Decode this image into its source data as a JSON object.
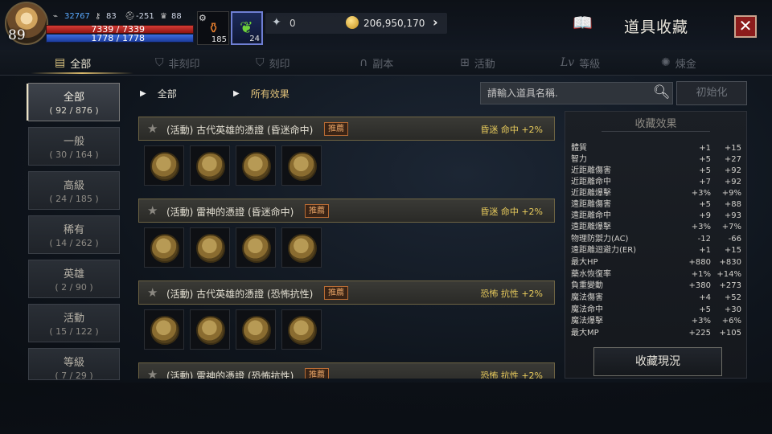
{
  "player": {
    "level": "89",
    "power": "32767",
    "stat_key": "83",
    "stat_helmet": "-251",
    "stat_trophy": "88",
    "hp": "7339 / 7339",
    "mp": "1778 / 1778"
  },
  "quick_slots": {
    "potion_count": "185",
    "herb_count": "24"
  },
  "currency": {
    "gems": "0",
    "gold": "206,950,170"
  },
  "header": {
    "title": "道具收藏"
  },
  "tabs": [
    {
      "label": "全部",
      "icon": "book-icon"
    },
    {
      "label": "非刻印",
      "icon": "shield-icon"
    },
    {
      "label": "刻印",
      "icon": "shield-icon"
    },
    {
      "label": "副本",
      "icon": "gate-icon"
    },
    {
      "label": "活動",
      "icon": "gift-icon"
    },
    {
      "label": "等級",
      "icon": "lv-icon"
    },
    {
      "label": "煉金",
      "icon": "alchemy-icon"
    }
  ],
  "categories": [
    {
      "name": "全部",
      "count": "( 92 / 876 )"
    },
    {
      "name": "一般",
      "count": "( 30 / 164 )"
    },
    {
      "name": "高級",
      "count": "( 24 / 185 )"
    },
    {
      "name": "稀有",
      "count": "( 14 / 262 )"
    },
    {
      "name": "英雄",
      "count": "( 2 / 90 )"
    },
    {
      "name": "活動",
      "count": "( 15 / 122 )"
    },
    {
      "name": "等級",
      "count": "( 7 / 29 )"
    }
  ],
  "breadcrumb": {
    "first": "全部",
    "second": "所有效果"
  },
  "search": {
    "placeholder": "請輸入道具名稱."
  },
  "reset_label": "初始化",
  "groups": [
    {
      "name": "(活動) 古代英雄的憑證 (昏迷命中)",
      "badge": "推薦",
      "effect": "昏迷 命中 +2%"
    },
    {
      "name": "(活動) 雷神的憑證 (昏迷命中)",
      "badge": "推薦",
      "effect": "昏迷 命中 +2%"
    },
    {
      "name": "(活動) 古代英雄的憑證 (恐怖抗性)",
      "badge": "推薦",
      "effect": "恐怖 抗性 +2%"
    },
    {
      "name": "(活動) 雷神的憑證 (恐怖抗性)",
      "badge": "推薦",
      "effect": "恐怖 抗性 +2%"
    }
  ],
  "effects": {
    "title": "收藏效果",
    "rows": [
      {
        "name": "體質",
        "v1": "+1",
        "v2": "+15"
      },
      {
        "name": "智力",
        "v1": "+5",
        "v2": "+27"
      },
      {
        "name": "近距離傷害",
        "v1": "+5",
        "v2": "+92"
      },
      {
        "name": "近距離命中",
        "v1": "+7",
        "v2": "+92"
      },
      {
        "name": "近距離爆擊",
        "v1": "+3%",
        "v2": "+9%"
      },
      {
        "name": "遠距離傷害",
        "v1": "+5",
        "v2": "+88"
      },
      {
        "name": "遠距離命中",
        "v1": "+9",
        "v2": "+93"
      },
      {
        "name": "遠距離爆擊",
        "v1": "+3%",
        "v2": "+7%"
      },
      {
        "name": "物理防禦力(AC)",
        "v1": "-12",
        "v2": "-66"
      },
      {
        "name": "遠距離迴避力(ER)",
        "v1": "+1",
        "v2": "+15"
      },
      {
        "name": "最大HP",
        "v1": "+880",
        "v2": "+830"
      },
      {
        "name": "藥水恢復率",
        "v1": "+1%",
        "v2": "+14%"
      },
      {
        "name": "負重變動",
        "v1": "+380",
        "v2": "+273"
      },
      {
        "name": "魔法傷害",
        "v1": "+4",
        "v2": "+52"
      },
      {
        "name": "魔法命中",
        "v1": "+5",
        "v2": "+30"
      },
      {
        "name": "魔法爆擊",
        "v1": "+3%",
        "v2": "+6%"
      },
      {
        "name": "最大MP",
        "v1": "+225",
        "v2": "+105"
      }
    ],
    "button_label": "收藏現況"
  }
}
